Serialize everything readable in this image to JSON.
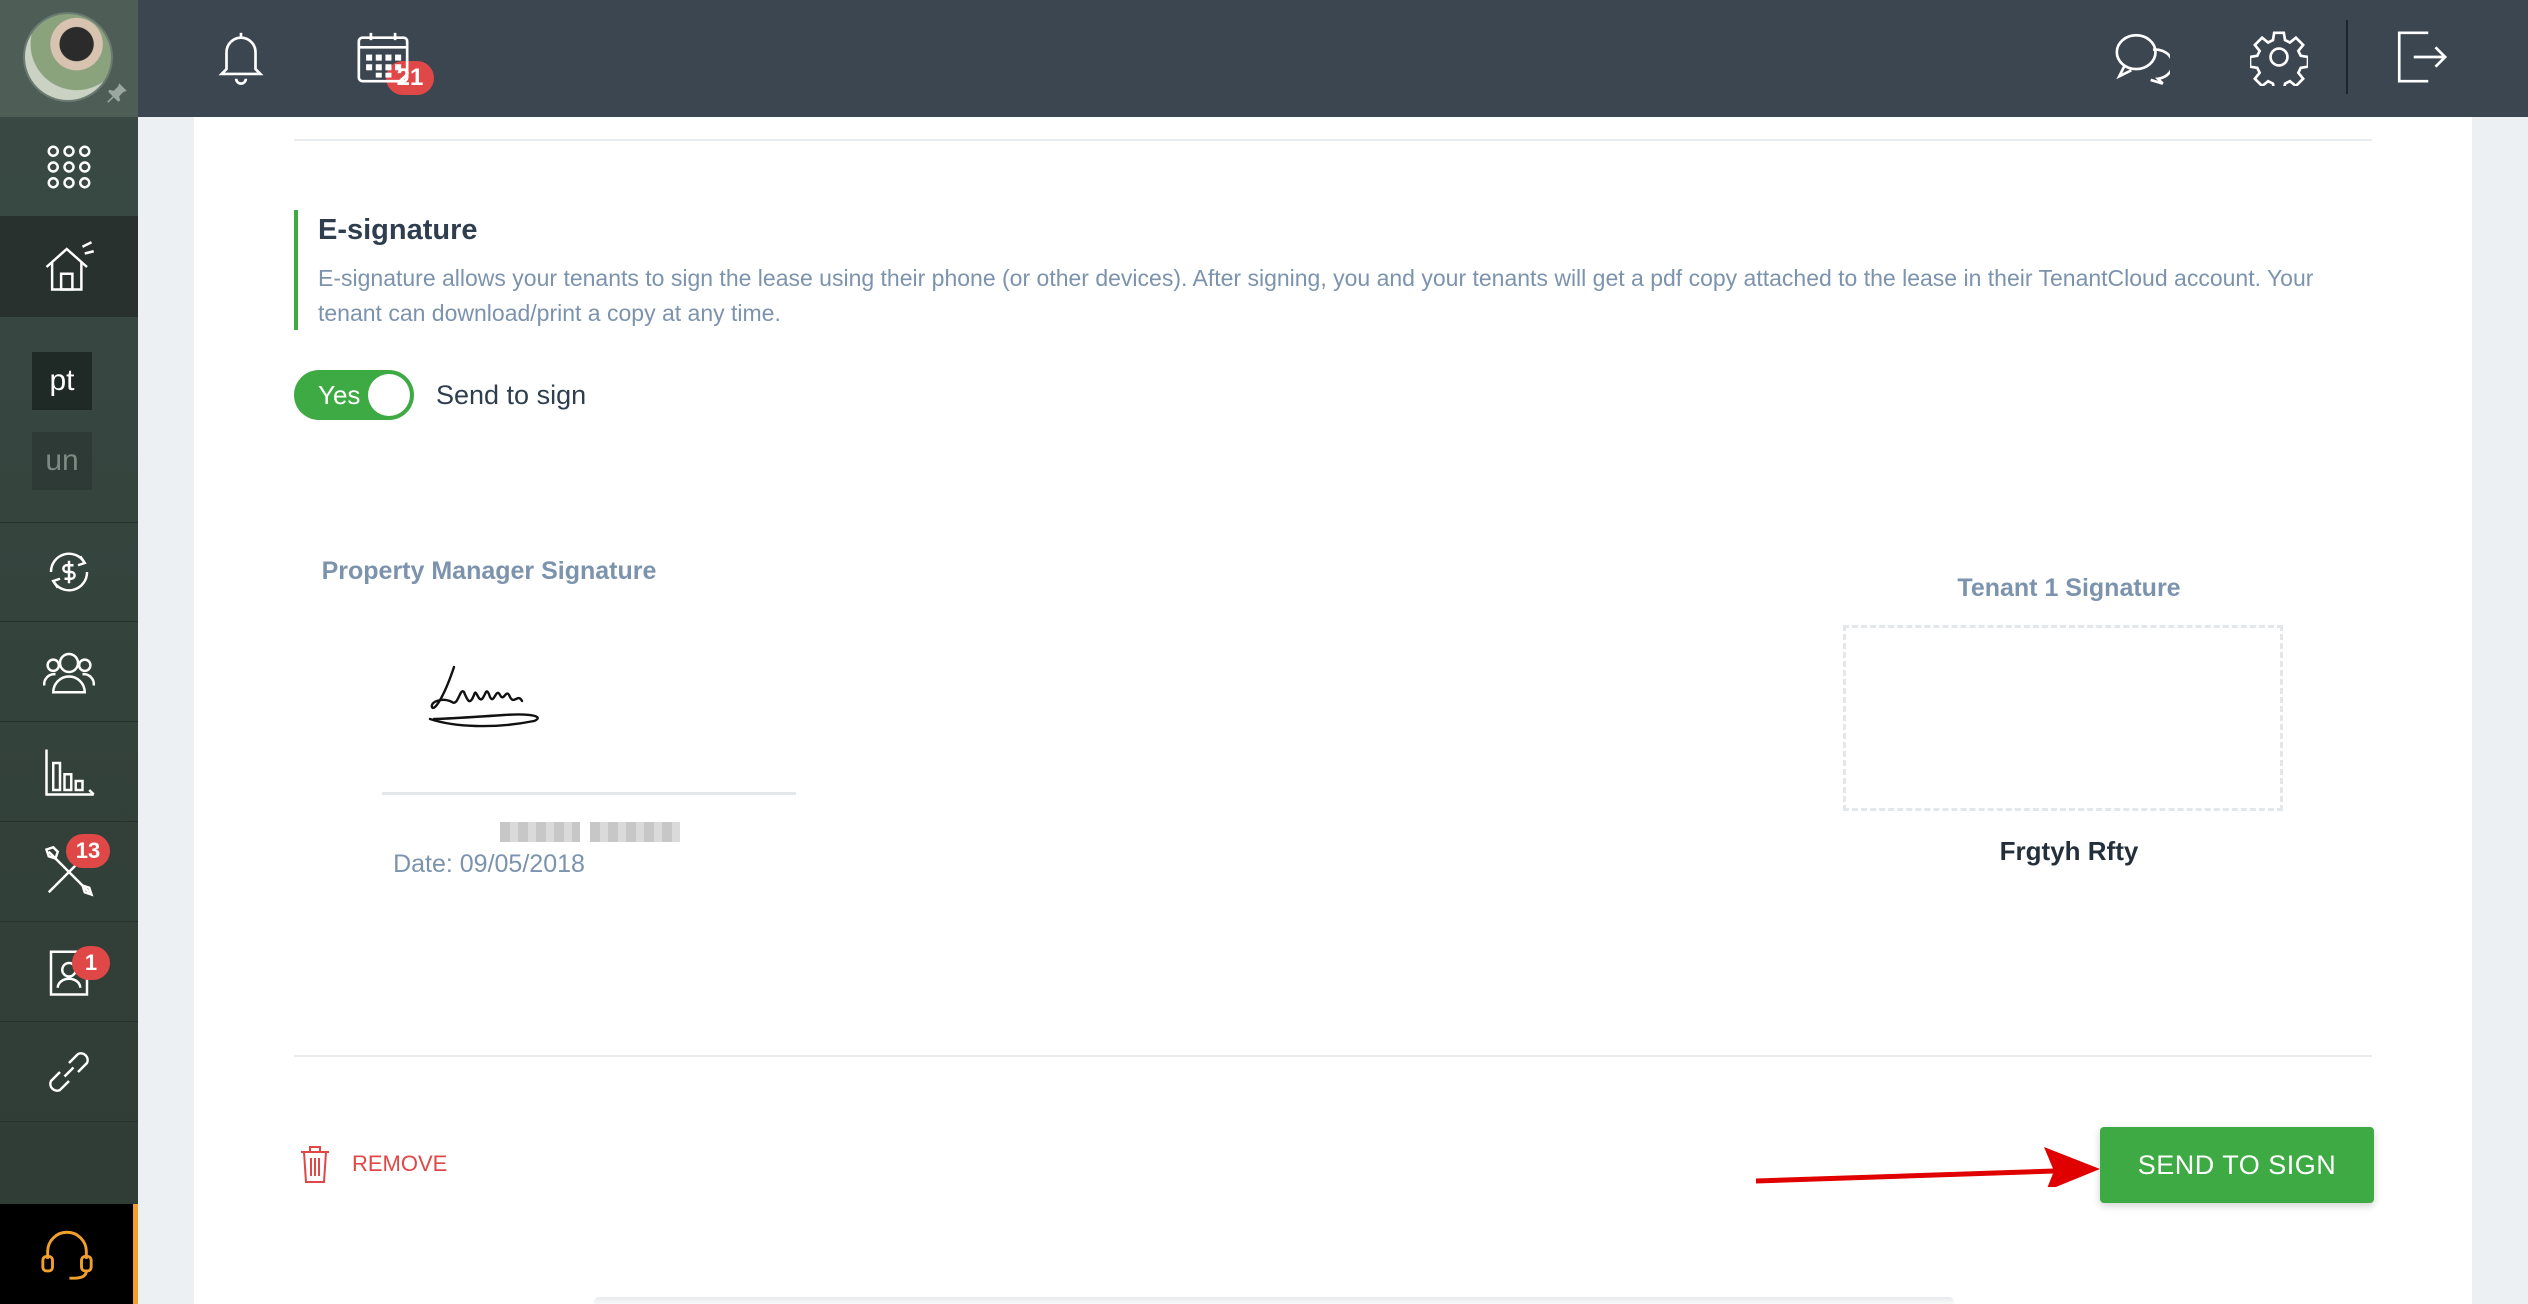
{
  "topbar": {
    "notifications_count": "21"
  },
  "sidebar": {
    "squares": {
      "pt": "pt",
      "un": "un"
    },
    "maintenance_badge": "13",
    "applications_badge": "1"
  },
  "esignature": {
    "title": "E-signature",
    "description": "E-signature allows your tenants to sign the lease using their phone (or other devices). After signing, you and your tenants will get a pdf copy attached to the lease in their TenantCloud account. Your tenant can download/print a copy at any time.",
    "toggle_value": "Yes",
    "toggle_label": "Send to sign"
  },
  "property_manager": {
    "title": "Property Manager Signature",
    "date": "Date: 09/05/2018"
  },
  "tenant": {
    "title": "Tenant 1 Signature",
    "name": "Frgtyh Rfty"
  },
  "actions": {
    "remove_label": "REMOVE",
    "send_label": "SEND TO SIGN"
  },
  "colors": {
    "accent_green": "#3eaa44",
    "badge_red": "#e04848",
    "topbar": "#3b4651"
  }
}
